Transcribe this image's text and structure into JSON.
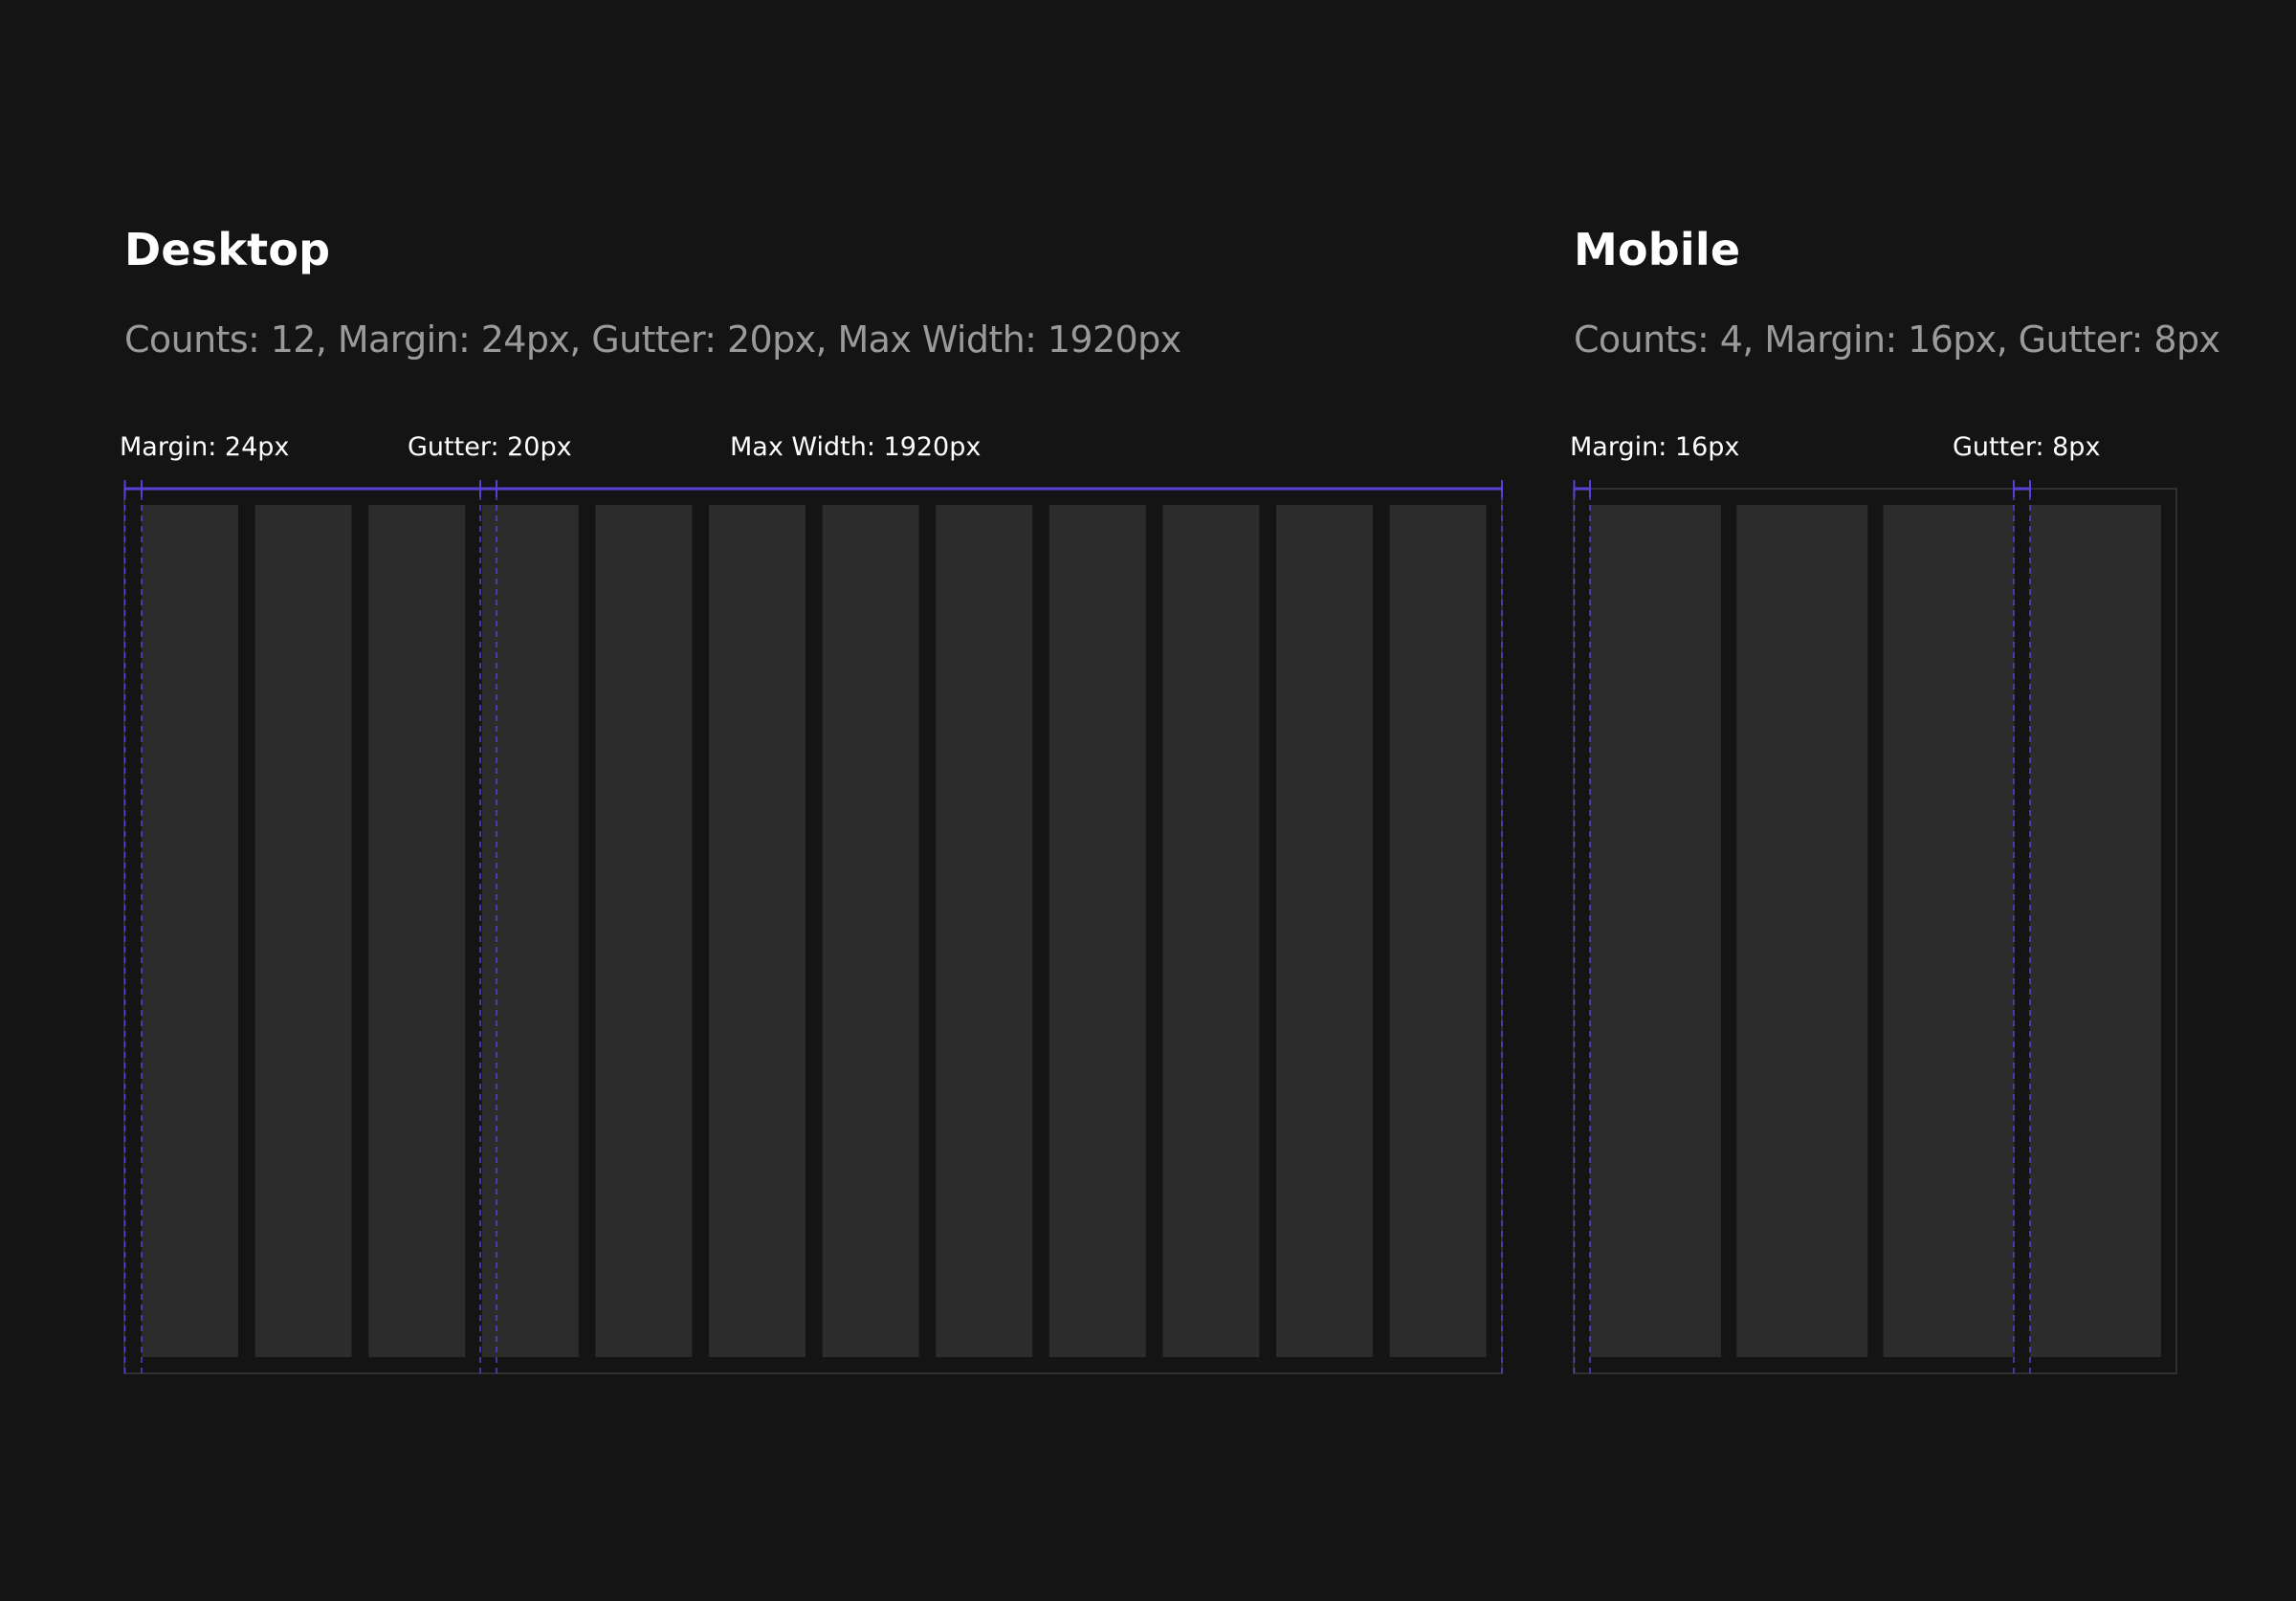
{
  "desktop": {
    "title": "Desktop",
    "description": "Counts: 12, Margin: 24px, Gutter: 20px, Max Width: 1920px",
    "column_count": 12,
    "annotations": {
      "margin": "Margin: 24px",
      "gutter": "Gutter: 20px",
      "max_width": "Max Width: 1920px"
    }
  },
  "mobile": {
    "title": "Mobile",
    "description": "Counts: 4, Margin: 16px, Gutter: 8px",
    "column_count": 4,
    "annotations": {
      "margin": "Margin: 16px",
      "gutter": "Gutter: 8px"
    }
  },
  "colors": {
    "background": "#141414",
    "column_fill": "#2c2c2c",
    "frame_border": "#3a3a3a",
    "guide_accent": "#5b3fd6",
    "title_text": "#ffffff",
    "description_text": "#9a9a9a"
  }
}
